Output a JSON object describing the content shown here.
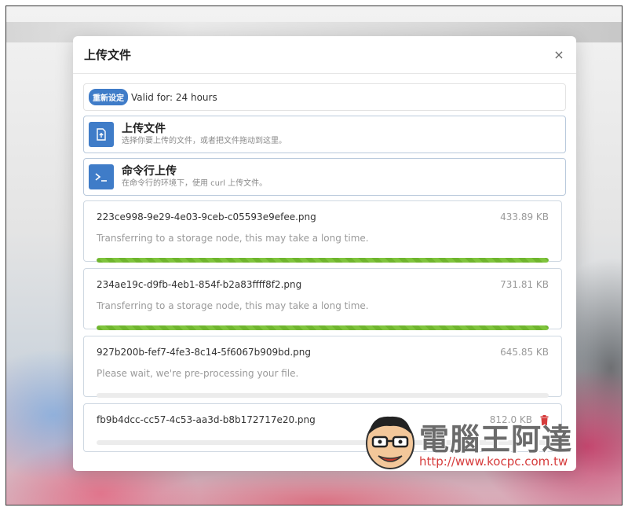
{
  "modal": {
    "title": "上传文件",
    "close_label": "×"
  },
  "validity": {
    "reset_label": "重新设定",
    "text": "Valid for: 24 hours"
  },
  "actions": [
    {
      "title": "上传文件",
      "description": "选择你要上传的文件，或者把文件拖动到这里。",
      "icon": "file-upload-icon"
    },
    {
      "title": "命令行上传",
      "description": "在命令行的环境下，使用 curl 上传文件。",
      "icon": "terminal-icon"
    }
  ],
  "files": [
    {
      "name": "223ce998-9e29-4e03-9ceb-c05593e9efee.png",
      "size": "433.89 KB",
      "status": "Transferring to a storage node, this may take a long time.",
      "progress": 1.0
    },
    {
      "name": "234ae19c-d9fb-4eb1-854f-b2a83ffff8f2.png",
      "size": "731.81 KB",
      "status": "Transferring to a storage node, this may take a long time.",
      "progress": 1.0
    },
    {
      "name": "927b200b-fef7-4fe3-8c14-5f6067b909bd.png",
      "size": "645.85 KB",
      "status": "Please wait, we're pre-processing your file.",
      "progress": 0.0
    },
    {
      "name": "fb9b4dcc-cc57-4c53-aa3d-b8b172717e20.png",
      "size": "812.0 KB",
      "status": "",
      "progress": 0.0
    }
  ],
  "watermark": {
    "text": "電腦王阿達",
    "url": "http://www.kocpc.com.tw"
  },
  "colors": {
    "accent": "#3f7cc8",
    "progress": "#6fb52e",
    "delete": "#d63c3c"
  }
}
